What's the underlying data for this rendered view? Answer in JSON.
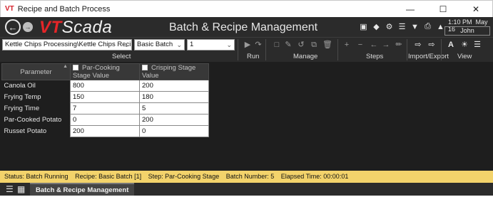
{
  "window": {
    "logo": "VT",
    "title": "Recipe and Batch Process",
    "minimize": "—",
    "maximize": "☐",
    "close": "✕"
  },
  "header": {
    "brand_vt": "VT",
    "brand_scada": "Scada",
    "page_title": "Batch & Recipe Management",
    "time": "1:10 PM",
    "date": "May 16",
    "user": "John",
    "icons": [
      "image-icon",
      "tag-icon",
      "gear-icon",
      "list-icon",
      "filter-icon",
      "print-icon",
      "bell-icon"
    ]
  },
  "select": {
    "recipe_book": "Kettle Chips Processing\\Kettle Chips Recipes",
    "recipe": "Basic Batch",
    "batch_number": "1",
    "label": "Select"
  },
  "groups": {
    "run": "Run",
    "manage": "Manage",
    "steps": "Steps",
    "import_export": "Import/Export",
    "view": "View"
  },
  "table": {
    "col_parameter": "Parameter",
    "col_stage1": "Par-Cooking Stage Value",
    "col_stage2": "Crisping Stage Value",
    "rows": [
      {
        "name": "Canola Oil",
        "v1": "800",
        "v2": "200"
      },
      {
        "name": "Frying Temp",
        "v1": "150",
        "v2": "180"
      },
      {
        "name": "Frying Time",
        "v1": "7",
        "v2": "5"
      },
      {
        "name": "Par-Cooked Potato",
        "v1": "0",
        "v2": "200"
      },
      {
        "name": "Russet Potato",
        "v1": "200",
        "v2": "0"
      }
    ]
  },
  "status": {
    "status": "Status: Batch Running",
    "recipe": "Recipe: Basic Batch [1]",
    "step": "Step: Par-Cooking Stage",
    "batch": "Batch Number: 5",
    "elapsed": "Elapsed Time: 00:00:01"
  },
  "bottom": {
    "tab": "Batch & Recipe Management"
  },
  "colors": {
    "header_bg": "#2b2b2b",
    "brand_red": "#e52528",
    "status_bg": "#f3d36b"
  }
}
